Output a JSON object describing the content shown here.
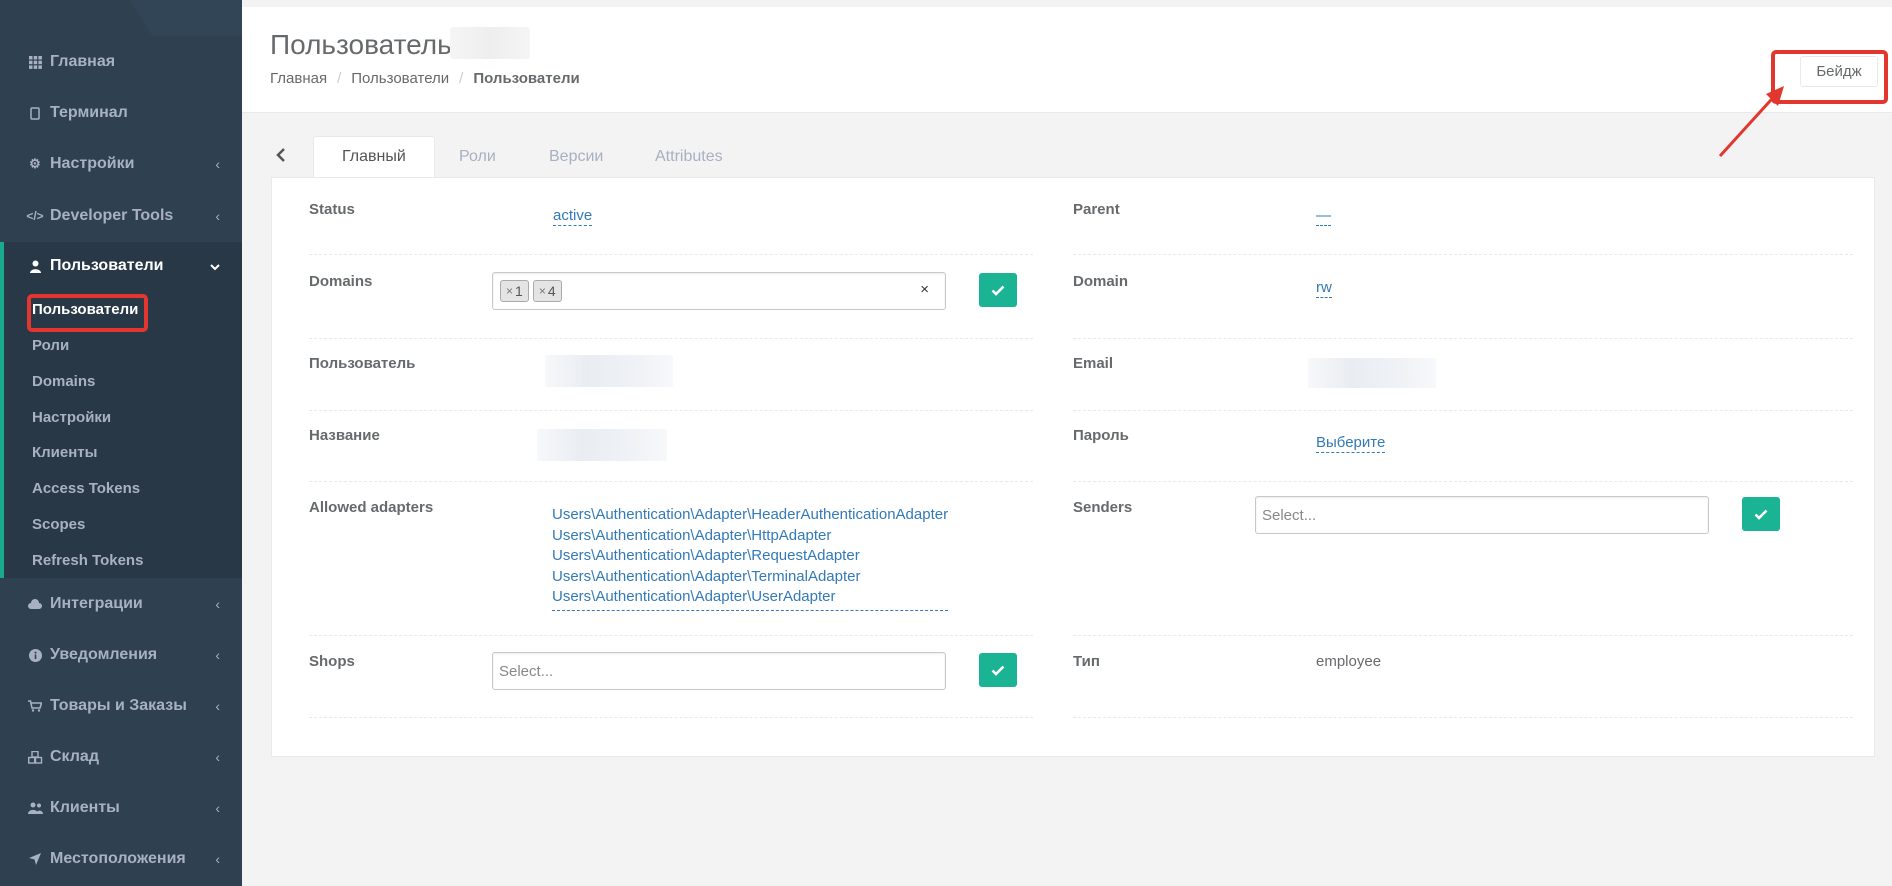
{
  "sidebar": {
    "items": [
      {
        "label": "Главная",
        "icon": "grid-icon"
      },
      {
        "label": "Терминал",
        "icon": "terminal-icon"
      },
      {
        "label": "Настройки",
        "icon": "gear-icon"
      },
      {
        "label": "Developer Tools",
        "icon": "code-icon"
      },
      {
        "label": "Пользователи",
        "icon": "user-icon"
      },
      {
        "label": "Интеграции",
        "icon": "cloud-icon"
      },
      {
        "label": "Уведомления",
        "icon": "info-icon"
      },
      {
        "label": "Товары и Заказы",
        "icon": "cart-icon"
      },
      {
        "label": "Склад",
        "icon": "cubes-icon"
      },
      {
        "label": "Клиенты",
        "icon": "users-icon"
      },
      {
        "label": "Местоположения",
        "icon": "location-arrow-icon"
      }
    ],
    "submenu": [
      "Пользователи",
      "Роли",
      "Domains",
      "Настройки",
      "Клиенты",
      "Access Tokens",
      "Scopes",
      "Refresh Tokens"
    ]
  },
  "header": {
    "title": "Пользователь",
    "breadcrumb": [
      "Главная",
      "Пользователи",
      "Пользователи"
    ],
    "badge_button": "Бейдж"
  },
  "tabs": [
    "Главный",
    "Роли",
    "Версии",
    "Attributes"
  ],
  "form": {
    "status_label": "Status",
    "status_value": "active",
    "parent_label": "Parent",
    "parent_value": "—",
    "domains_label": "Domains",
    "domains_chips": [
      "1",
      "4"
    ],
    "domains_clear": "×",
    "domain_label": "Domain",
    "domain_value": "rw",
    "user_label": "Пользователь",
    "email_label": "Email",
    "name_label": "Название",
    "password_label": "Пароль",
    "password_value": "Выберите",
    "adapters_label": "Allowed adapters",
    "adapters": [
      "Users\\Authentication\\Adapter\\HeaderAuthenticationAdapter",
      "Users\\Authentication\\Adapter\\HttpAdapter",
      "Users\\Authentication\\Adapter\\RequestAdapter",
      "Users\\Authentication\\Adapter\\TerminalAdapter",
      "Users\\Authentication\\Adapter\\UserAdapter"
    ],
    "senders_label": "Senders",
    "senders_placeholder": "Select...",
    "shops_label": "Shops",
    "shops_placeholder": "Select...",
    "type_label": "Тип",
    "type_value": "employee"
  },
  "colors": {
    "sidebar_bg": "#2f4050",
    "accent": "#1ab394",
    "link": "#337ab7",
    "highlight": "#e2372e"
  }
}
